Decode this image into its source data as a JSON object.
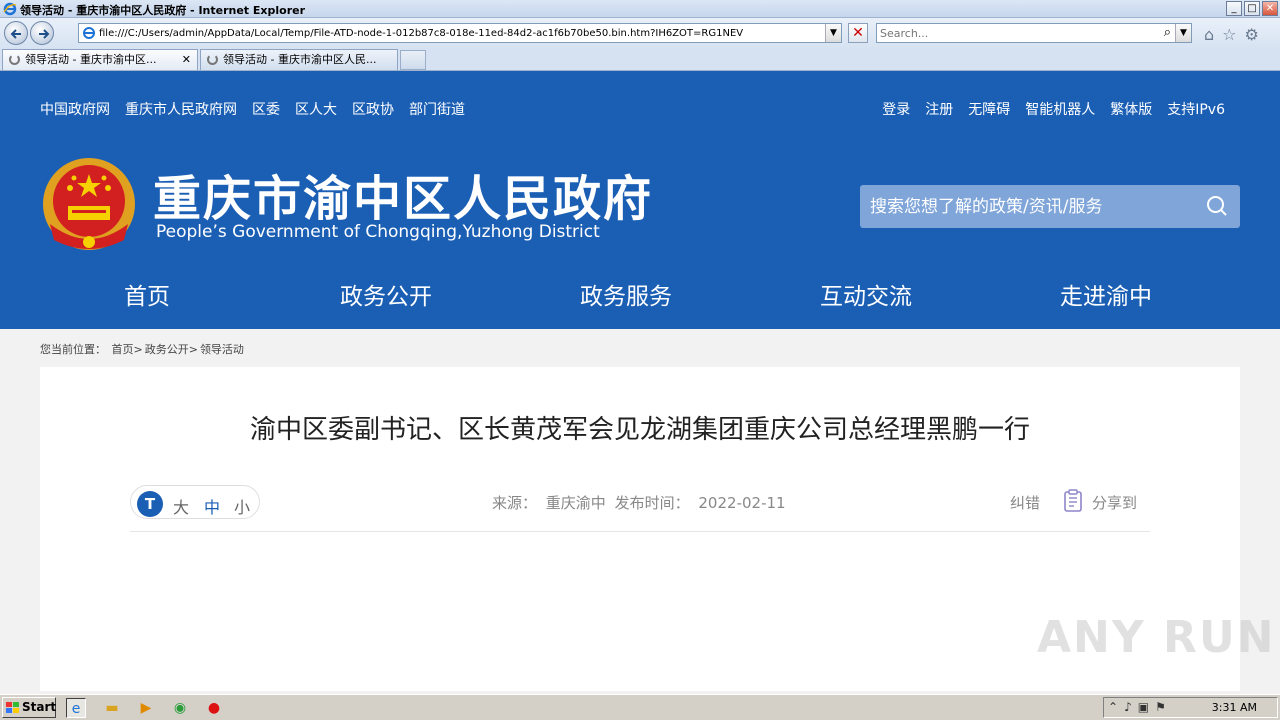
{
  "window": {
    "title": "领导活动 - 重庆市渝中区人民政府 - Internet Explorer",
    "min": "_",
    "max": "□",
    "close": "✕"
  },
  "browser": {
    "address": "file:///C:/Users/admin/AppData/Local/Temp/File-ATD-node-1-012b87c8-018e-11ed-84d2-ac1f6b70be50.bin.htm?IH6ZOT=RG1NEV",
    "search_placeholder": "Search...",
    "tabs": [
      {
        "label": "领导活动 - 重庆市渝中区...",
        "close": "✕"
      },
      {
        "label": "领导活动 - 重庆市渝中区人民..."
      }
    ]
  },
  "site": {
    "top_links": [
      "中国政府网",
      "重庆市人民政府网",
      "区委",
      "区人大",
      "区政协",
      "部门街道"
    ],
    "right_links": [
      "登录",
      "注册",
      "无障碍",
      "智能机器人",
      "繁体版",
      "支持IPv6"
    ],
    "title": "重庆市渝中区人民政府",
    "subtitle": "People’s Government of Chongqing,Yuzhong District",
    "search_placeholder": "搜索您想了解的政策/资讯/服务",
    "nav": [
      "首页",
      "政务公开",
      "政务服务",
      "互动交流",
      "走进渝中"
    ]
  },
  "breadcrumb": {
    "prefix": "您当前位置：",
    "items": [
      "首页",
      ">",
      "政务公开",
      ">",
      "领导活动"
    ]
  },
  "article": {
    "title": "渝中区委副书记、区长黄茂军会见龙湖集团重庆公司总经理黑鹏一行",
    "font_icon": "T",
    "font_large": "大",
    "font_medium": "中",
    "font_small": "小",
    "source_label": "来源：",
    "source": "重庆渝中",
    "date_label": "发布时间：",
    "date": "2022-02-11",
    "correction": "纠错",
    "share": "分享到"
  },
  "watermark": "ANY RUN",
  "taskbar": {
    "start": "Start",
    "clock": "3:31 AM"
  },
  "colors": {
    "header_blue": "#1b5fb5",
    "search_box": "#7fa5d9"
  }
}
